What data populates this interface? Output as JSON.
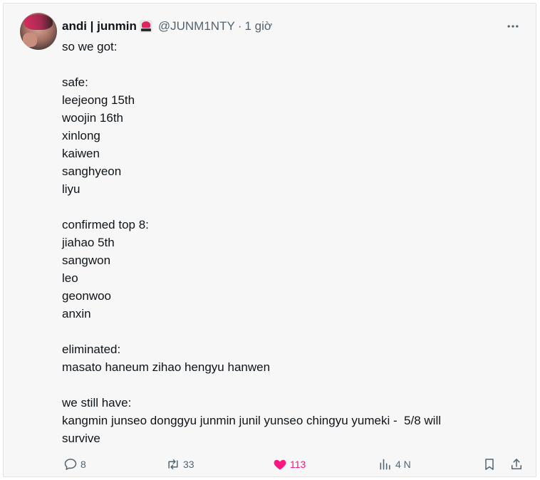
{
  "tweet": {
    "author_name": "andi | junmin",
    "handle": "@JUNM1NTY",
    "separator": "·",
    "time": "1 giờ",
    "lines": [
      "so we got:",
      "",
      "safe:",
      "leejeong 15th",
      "woojin 16th",
      "xinlong",
      "kaiwen",
      "sanghyeon",
      "liyu",
      "",
      "confirmed top 8:",
      "jiahao 5th",
      "sangwon",
      "leo",
      "geonwoo",
      "anxin",
      "",
      "eliminated:",
      "masato haneum zihao hengyu hanwen",
      "",
      "we still have:",
      "kangmin junseo donggyu junmin junil yunseo chingyu yumeki -  5/8 will",
      "survive"
    ]
  },
  "actions": {
    "reply_count": "8",
    "retweet_count": "33",
    "like_count": "113",
    "views_count": "4 N"
  },
  "icons": {
    "more": "more-horizontal-icon",
    "reply": "reply-icon",
    "retweet": "retweet-icon",
    "like": "heart-icon",
    "views": "analytics-icon",
    "bookmark": "bookmark-icon",
    "share": "share-icon"
  },
  "colors": {
    "text": "#0f1419",
    "secondary": "#536471",
    "like": "#f91880",
    "background": "#f7f7f7"
  }
}
